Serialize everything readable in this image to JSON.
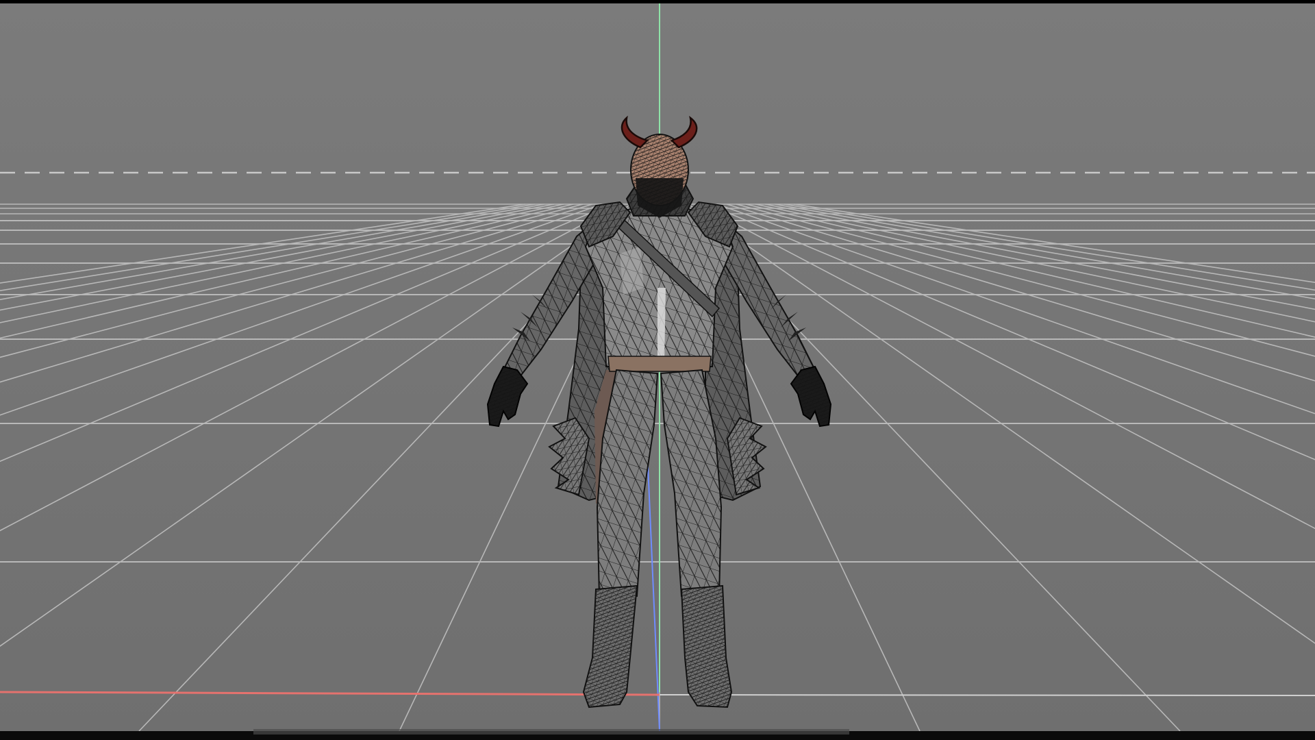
{
  "viewport": {
    "mode": "wireframe-on-shaded",
    "camera": "front",
    "colors": {
      "background_top": "#7b7b7b",
      "background_bottom": "#6f6f6f",
      "frame": "#000000",
      "grid": "#b8b8b8",
      "horizon_dashed": "#c8c8c8",
      "axis_x": "#e5726e",
      "axis_y": "#8fe3a8",
      "axis_z": "#6f8cff",
      "wire": "#111111",
      "mesh_fill": "#6a6a6a",
      "belt": "#8a7262",
      "horns": "#6b1f1a",
      "head_skin": "#a9826f"
    },
    "icons": {
      "model": "character-mesh-icon"
    }
  }
}
